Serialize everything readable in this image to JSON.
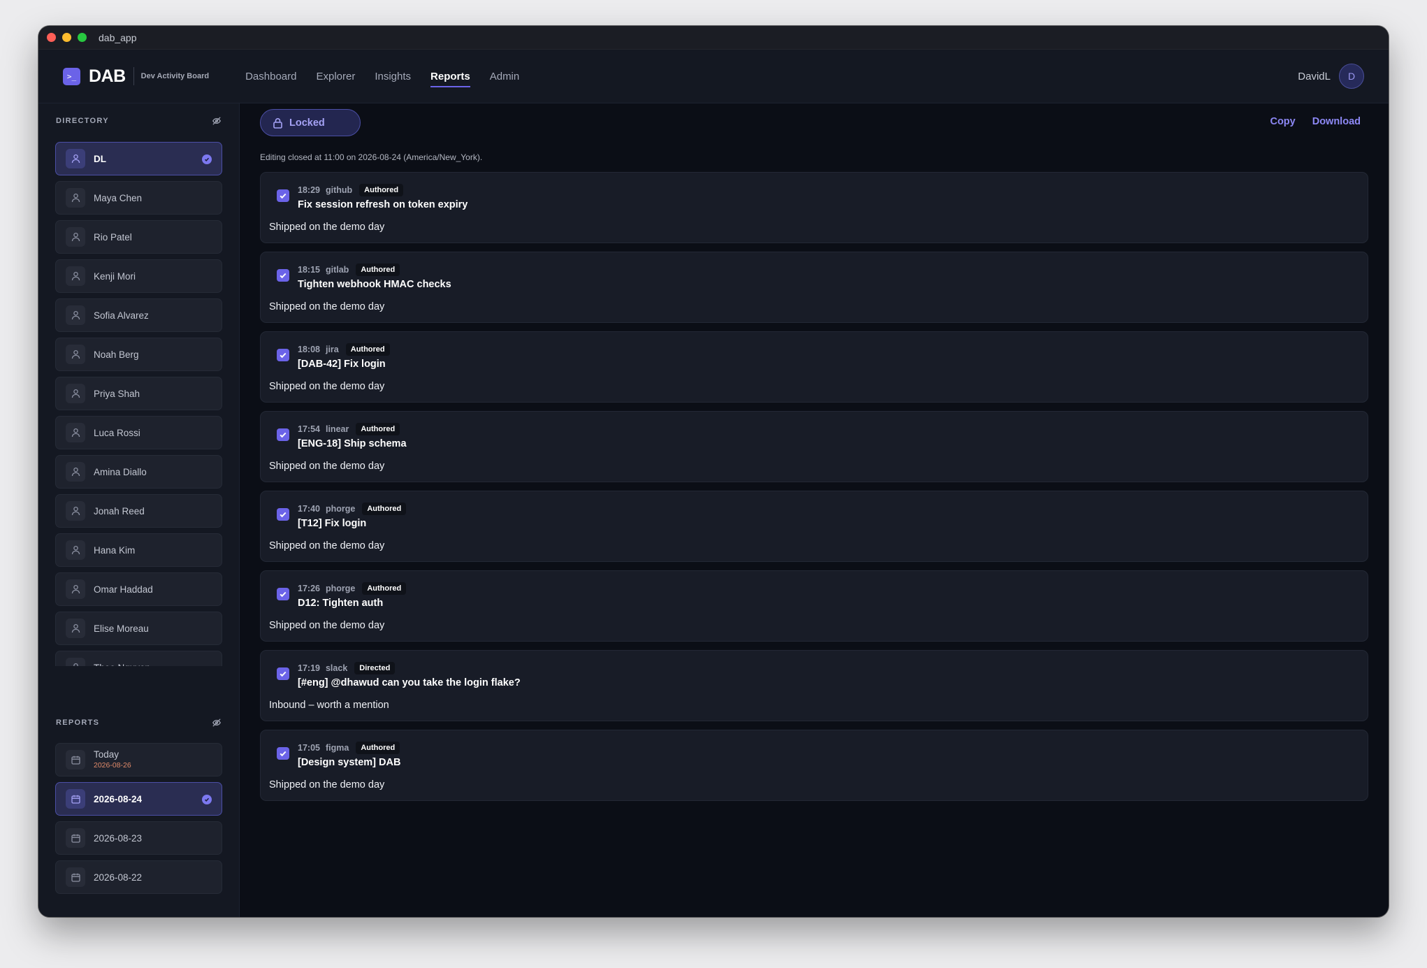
{
  "window": {
    "title": "dab_app"
  },
  "header": {
    "logo_icon": ">_",
    "logo_text": "DAB",
    "logo_sub": "Dev Activity Board",
    "nav": [
      "Dashboard",
      "Explorer",
      "Insights",
      "Reports",
      "Admin"
    ],
    "active_nav": "Reports",
    "user_name": "DavidL",
    "avatar_initial": "D"
  },
  "sidebar": {
    "directory_title": "DIRECTORY",
    "directory": [
      "DL",
      "Maya Chen",
      "Rio Patel",
      "Kenji Mori",
      "Sofia Alvarez",
      "Noah Berg",
      "Priya Shah",
      "Luca Rossi",
      "Amina Diallo",
      "Jonah Reed",
      "Hana Kim",
      "Omar Haddad",
      "Elise Moreau",
      "Theo Nguyen"
    ],
    "directory_active": "DL",
    "reports_title": "REPORTS",
    "reports": [
      {
        "label": "Today",
        "date": "2026-08-26"
      },
      {
        "label": "2026-08-24"
      },
      {
        "label": "2026-08-23"
      },
      {
        "label": "2026-08-22"
      }
    ],
    "reports_active": "2026-08-24"
  },
  "main": {
    "locked_label": "Locked",
    "copy_label": "Copy",
    "download_label": "Download",
    "edit_note": "Editing closed at 11:00 on 2026-08-24 (America/New_York).",
    "entries": [
      {
        "time": "18:29",
        "source": "github",
        "badge": "Authored",
        "title": "Fix session refresh on token expiry",
        "note": "Shipped on the demo day",
        "checked": true
      },
      {
        "time": "18:15",
        "source": "gitlab",
        "badge": "Authored",
        "title": "Tighten webhook HMAC checks",
        "note": "Shipped on the demo day",
        "checked": true
      },
      {
        "time": "18:08",
        "source": "jira",
        "badge": "Authored",
        "title": "[DAB-42] Fix login",
        "note": "Shipped on the demo day",
        "checked": true
      },
      {
        "time": "17:54",
        "source": "linear",
        "badge": "Authored",
        "title": "[ENG-18] Ship schema",
        "note": "Shipped on the demo day",
        "checked": true
      },
      {
        "time": "17:40",
        "source": "phorge",
        "badge": "Authored",
        "title": "[T12] Fix login",
        "note": "Shipped on the demo day",
        "checked": true
      },
      {
        "time": "17:26",
        "source": "phorge",
        "badge": "Authored",
        "title": "D12: Tighten auth",
        "note": "Shipped on the demo day",
        "checked": true
      },
      {
        "time": "17:19",
        "source": "slack",
        "badge": "Directed",
        "title": "[#eng] @dhawud can you take the login flake?",
        "note": "Inbound – worth a mention",
        "checked": true
      },
      {
        "time": "17:05",
        "source": "figma",
        "badge": "Authored",
        "title": "[Design system] DAB",
        "note": "Shipped on the demo day",
        "checked": true
      }
    ]
  },
  "colors": {
    "accent": "#6b63e8",
    "bg": "#0b0e16",
    "panel": "#141822",
    "today_date": "#e08a6a"
  }
}
